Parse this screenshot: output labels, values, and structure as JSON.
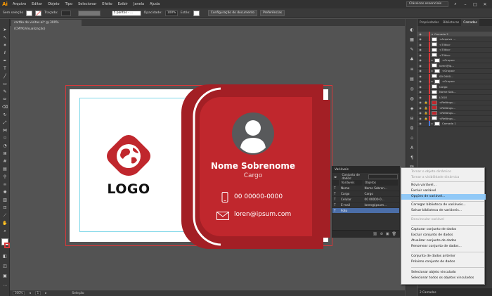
{
  "menubar": {
    "app_icon": "Ai",
    "items": [
      "Arquivo",
      "Editar",
      "Objeto",
      "Tipo",
      "Selecionar",
      "Efeito",
      "Exibir",
      "Janela",
      "Ajuda"
    ],
    "workspace": "Clássicos essenciais"
  },
  "control_bar": {
    "selection": "Sem seleção",
    "stroke_label": "Traçado:",
    "brush": "5 pontos - ...",
    "opacity_label": "Opacidade:",
    "opacity_value": "100%",
    "style_label": "Estilo:",
    "doc_setup": "Configuração do documento",
    "preferences": "Preferências"
  },
  "document_tab": "cartão de visitas.ai* @ 300% (CMYK/Visualização)",
  "card": {
    "logo_text": "LOGO",
    "name": "Nome Sobrenome",
    "role": "Cargo",
    "phone": "00 00000-0000",
    "email": "loren@ipsum.com",
    "colors": {
      "primary": "#c0272d",
      "dark": "#a31f25",
      "avatar": "#58595b"
    }
  },
  "variables_panel": {
    "title": "Variáveis",
    "dataset_label": "Conjunto de dados:",
    "columns": [
      "Variáveis",
      "Objetos"
    ],
    "rows": [
      {
        "name": "Nome",
        "object": "Nome Sobren..."
      },
      {
        "name": "Cargo",
        "object": "Cargo"
      },
      {
        "name": "Celular",
        "object": "00 00000-0..."
      },
      {
        "name": "E-mail",
        "object": "loren@ipsum..."
      },
      {
        "name": "Foto",
        "object": ""
      }
    ]
  },
  "layers_panel": {
    "tabs": [
      "Propriedades",
      "Bibliotecas",
      "Camadas"
    ],
    "rows": [
      "Camada 2",
      "<Arquivo ...",
      "<Tíltlo>",
      "<Tíltlo>",
      "<Tíltlo>",
      "<Grupo>",
      "loren@ip...",
      "<Grupo>",
      "00 0000...",
      "<Grupo>",
      "Cargo",
      "Nome Sob...",
      "LOGO",
      "<Retângu...",
      "<Retângu...",
      "<Retângu...",
      "<Retângu...",
      "Camada 1"
    ],
    "footer": "2 Camadas"
  },
  "context_menu": {
    "items": [
      {
        "label": "Tornar o objeto dinâmico",
        "enabled": false
      },
      {
        "label": "Tornar a visibilidade dinâmica",
        "enabled": false
      },
      {
        "label": "Nova variável...",
        "enabled": true
      },
      {
        "label": "Excluir variável",
        "enabled": true
      },
      {
        "label": "Opções de variável...",
        "enabled": true,
        "highlighted": true
      },
      {
        "label": "Carregar biblioteca de variáveis...",
        "enabled": true
      },
      {
        "label": "Salvar biblioteca de variáveis...",
        "enabled": true
      },
      {
        "label": "Desvincular variável",
        "enabled": false
      },
      {
        "label": "Capturar conjunto de dados",
        "enabled": true
      },
      {
        "label": "Excluir conjunto de dados",
        "enabled": true
      },
      {
        "label": "Atualizar conjunto de dados",
        "enabled": true
      },
      {
        "label": "Renomear conjunto de dados...",
        "enabled": true
      },
      {
        "label": "Conjunto de dados anterior",
        "enabled": true
      },
      {
        "label": "Próximo conjunto de dados",
        "enabled": true
      },
      {
        "label": "Selecionar objeto vinculado",
        "enabled": true
      },
      {
        "label": "Selecionar todos os objetos vinculados",
        "enabled": true
      }
    ]
  },
  "status_bar": {
    "zoom": "300%",
    "artboard": "1",
    "tool": "Seleção"
  }
}
